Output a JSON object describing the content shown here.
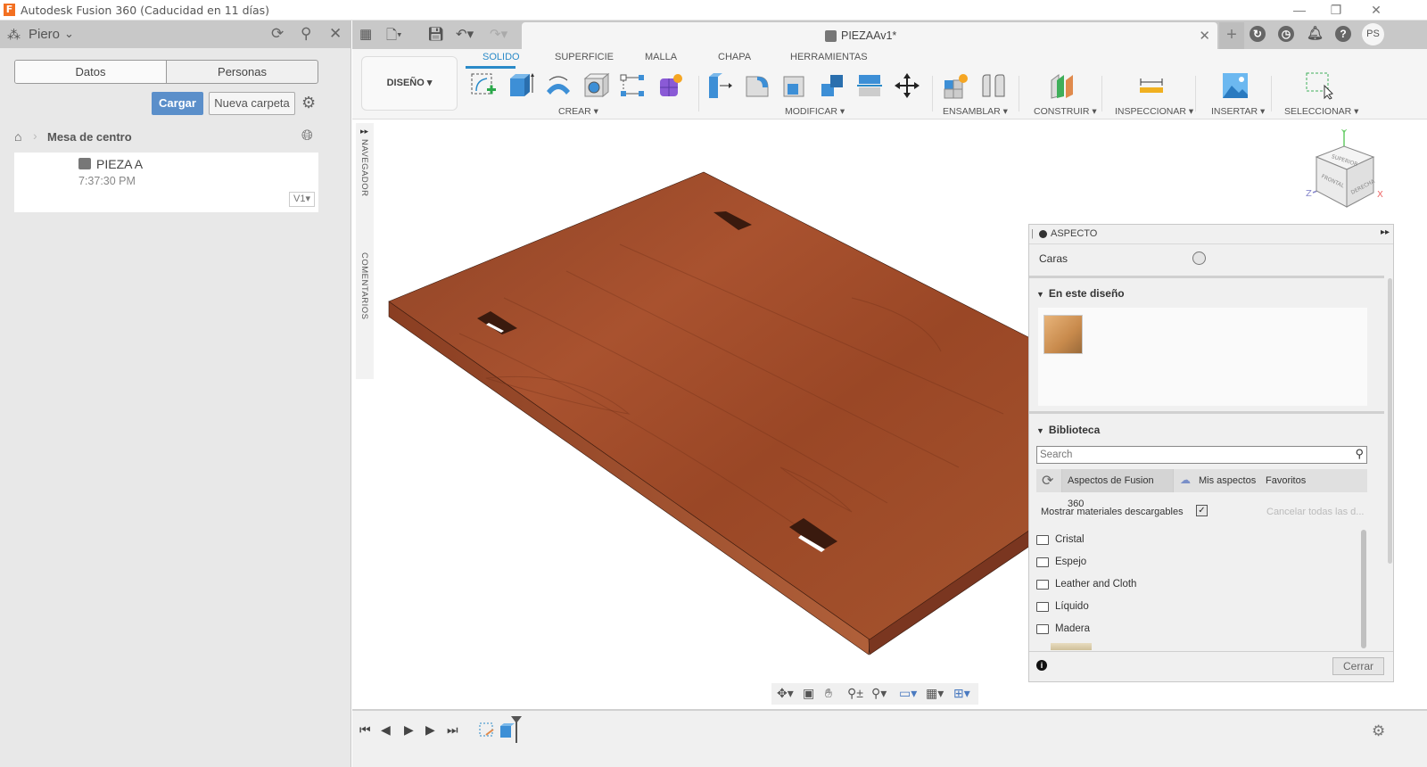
{
  "window": {
    "title": "Autodesk Fusion 360 (Caducidad en 11 días)",
    "logo_letter": "F",
    "minimize": "—",
    "maximize": "❐",
    "close": "✕"
  },
  "data_panel": {
    "team_name": "Piero",
    "tabs": [
      {
        "label": "Datos",
        "active": true
      },
      {
        "label": "Personas",
        "active": false
      }
    ],
    "upload_label": "Cargar",
    "new_folder_label": "Nueva carpeta",
    "breadcrumb": {
      "current": "Mesa de centro"
    },
    "files": [
      {
        "name": "PIEZA A",
        "time": "7:37:30 PM",
        "version": "V1▾"
      }
    ]
  },
  "tabbar": {
    "document_title": "PIEZAAv1*",
    "user_initials": "PS"
  },
  "ribbon": {
    "workspace": "DISEÑO ▾",
    "tabs": [
      {
        "label": "SOLIDO",
        "active": true
      },
      {
        "label": "SUPERFICIE",
        "active": false
      },
      {
        "label": "MALLA",
        "active": false
      },
      {
        "label": "CHAPA",
        "active": false
      },
      {
        "label": "HERRAMIENTAS",
        "active": false
      }
    ],
    "groups": [
      {
        "label": "CREAR ▾"
      },
      {
        "label": "MODIFICAR ▾"
      },
      {
        "label": "ENSAMBLAR ▾"
      },
      {
        "label": "CONSTRUIR ▾"
      },
      {
        "label": "INSPECCIONAR ▾"
      },
      {
        "label": "INSERTAR ▾"
      },
      {
        "label": "SELECCIONAR ▾"
      }
    ]
  },
  "side_strip": {
    "navigator": "NAVEGADOR",
    "comments": "COMENTARIOS"
  },
  "viewcube": {
    "top": "SUPERIOR",
    "front": "FRONTAL",
    "right": "DERECHA",
    "axis_x": "X",
    "axis_y": "Y",
    "axis_z": "Z"
  },
  "aspecto": {
    "title": "ASPECTO",
    "faces_label": "Caras",
    "in_design_title": "En este diseño",
    "library_title": "Biblioteca",
    "search_placeholder": "Search",
    "lib_tabs": [
      "Aspectos de Fusion 360",
      "Mis aspectos",
      "Favoritos"
    ],
    "show_downloadable_label": "Mostrar materiales descargables",
    "show_downloadable_checked": true,
    "cancel_all_label": "Cancelar todas las d...",
    "folders": [
      "Cristal",
      "Espejo",
      "Leather and Cloth",
      "Líquido",
      "Madera"
    ],
    "close_label": "Cerrar"
  },
  "colors": {
    "accent": "#2a8ac8",
    "upload_button": "#5b8fca",
    "wood": "#9a4a2a"
  }
}
